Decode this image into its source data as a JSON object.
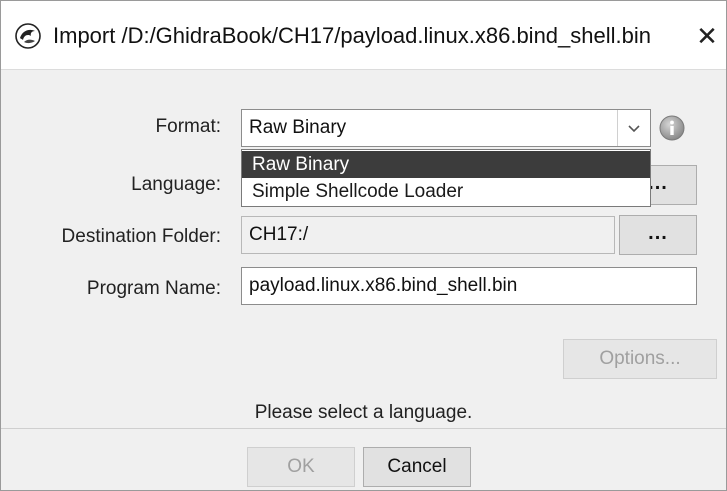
{
  "window": {
    "title": "Import /D:/GhidraBook/CH17/payload.linux.x86.bind_shell.bin",
    "close_glyph": "✕",
    "app_icon": "ghidra-dragon-icon"
  },
  "form": {
    "format": {
      "label": "Format:",
      "value": "Raw Binary",
      "options": [
        "Raw Binary",
        "Simple Shellcode Loader"
      ],
      "highlighted_option": "Raw Binary",
      "expanded": true,
      "info_icon": "info-icon"
    },
    "language": {
      "label": "Language:",
      "value": "",
      "browse_label": "..."
    },
    "destination_folder": {
      "label": "Destination Folder:",
      "value": "CH17:/",
      "browse_label": "..."
    },
    "program_name": {
      "label": "Program Name:",
      "value": "payload.linux.x86.bind_shell.bin"
    }
  },
  "buttons": {
    "options_label": "Options...",
    "ok_label": "OK",
    "cancel_label": "Cancel"
  },
  "status": {
    "message": "Please select a language."
  }
}
